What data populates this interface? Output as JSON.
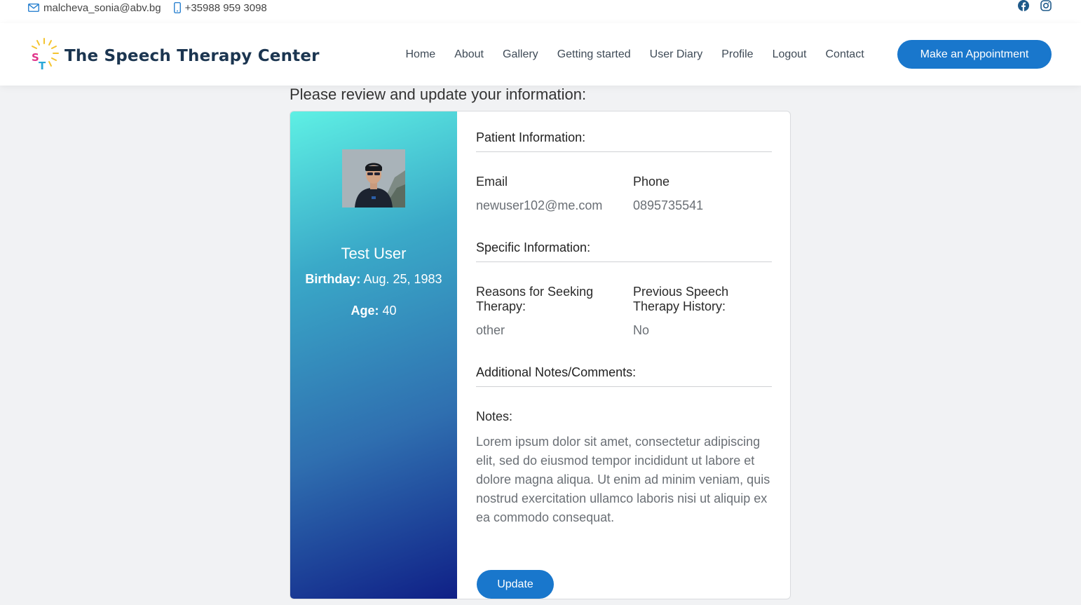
{
  "topbar": {
    "email": "malcheva_sonia@abv.bg",
    "phone": "+35988 959 3098",
    "icons": [
      "envelope-icon",
      "phone-icon",
      "facebook-icon",
      "instagram-icon"
    ]
  },
  "header": {
    "logo_text": "The Speech Therapy Center",
    "nav": [
      "Home",
      "About",
      "Gallery",
      "Getting started",
      "User Diary",
      "Profile",
      "Logout",
      "Contact"
    ],
    "cta": "Make an Appointment"
  },
  "page": {
    "heading": "Please review and update your information:"
  },
  "profile": {
    "name": "Test User",
    "birthday_label": "Birthday:",
    "birthday": "Aug. 25, 1983",
    "age_label": "Age:",
    "age": "40"
  },
  "patient_info": {
    "title": "Patient Information:",
    "email_label": "Email",
    "email": "newuser102@me.com",
    "phone_label": "Phone",
    "phone": "0895735541"
  },
  "specific_info": {
    "title": "Specific Information:",
    "reasons_label": "Reasons for Seeking Therapy:",
    "reasons": "other",
    "history_label": "Previous Speech Therapy History:",
    "history": "No"
  },
  "notes": {
    "title": "Additional Notes/Comments:",
    "label": "Notes:",
    "text": "Lorem ipsum dolor sit amet, consectetur adipiscing elit, sed do eiusmod tempor incididunt ut labore et dolore magna aliqua. Ut enim ad minim veniam, quis nostrud exercitation ullamco laboris nisi ut aliquip ex ea commodo consequat."
  },
  "actions": {
    "update": "Update"
  },
  "colors": {
    "brand_blue": "#1977cc",
    "logo_navy": "#1b3550",
    "gradient_top": "#5ef0e4",
    "gradient_bottom": "#0f1f86"
  }
}
